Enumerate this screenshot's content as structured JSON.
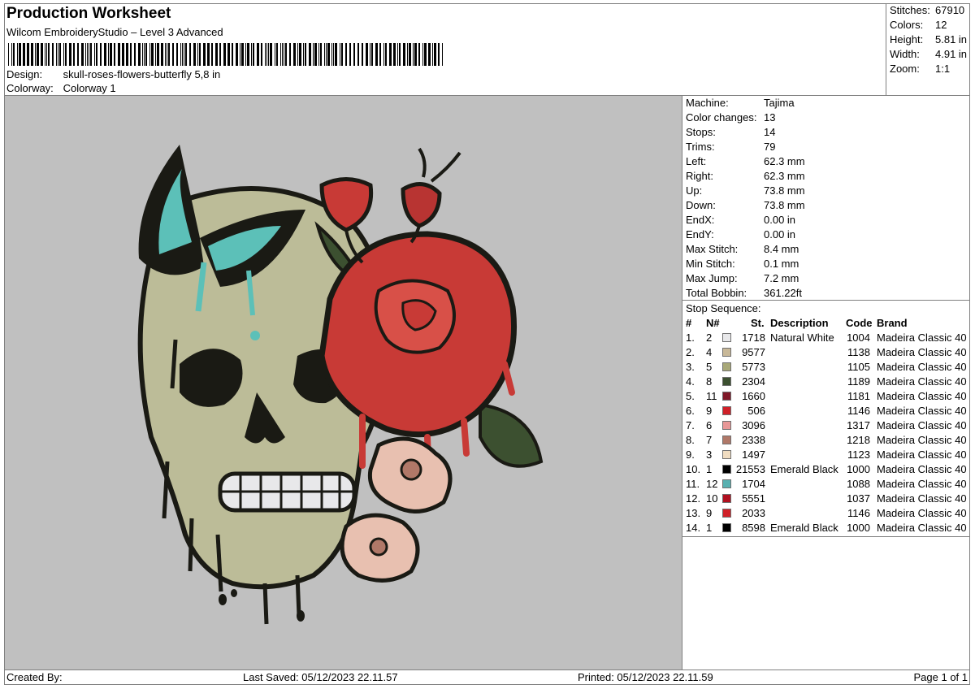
{
  "header": {
    "title": "Production Worksheet",
    "subtitle": "Wilcom EmbroideryStudio – Level 3 Advanced",
    "design_label": "Design:",
    "design_value": "skull-roses-flowers-butterfly 5,8 in",
    "colorway_label": "Colorway:",
    "colorway_value": "Colorway 1"
  },
  "stats": [
    {
      "label": "Stitches:",
      "value": "67910"
    },
    {
      "label": "Colors:",
      "value": "12"
    },
    {
      "label": "Height:",
      "value": "5.81 in"
    },
    {
      "label": "Width:",
      "value": "4.91 in"
    },
    {
      "label": "Zoom:",
      "value": "1:1"
    }
  ],
  "machine_info": [
    {
      "label": "Machine:",
      "value": "Tajima"
    },
    {
      "label": "Color changes:",
      "value": "13"
    },
    {
      "label": "Stops:",
      "value": "14"
    },
    {
      "label": "Trims:",
      "value": "79"
    },
    {
      "label": "Left:",
      "value": "62.3 mm"
    },
    {
      "label": "Right:",
      "value": "62.3 mm"
    },
    {
      "label": "Up:",
      "value": "73.8 mm"
    },
    {
      "label": "Down:",
      "value": "73.8 mm"
    },
    {
      "label": "EndX:",
      "value": "0.00 in"
    },
    {
      "label": "EndY:",
      "value": "0.00 in"
    },
    {
      "label": "Max Stitch:",
      "value": "8.4 mm"
    },
    {
      "label": "Min Stitch:",
      "value": "0.1 mm"
    },
    {
      "label": "Max Jump:",
      "value": "7.2 mm"
    },
    {
      "label": "Total Bobbin:",
      "value": "361.22ft"
    }
  ],
  "stop_sequence": {
    "title": "Stop Sequence:",
    "headers": {
      "num": "#",
      "n": "N#",
      "st": "St.",
      "desc": "Description",
      "code": "Code",
      "brand": "Brand"
    },
    "rows": [
      {
        "num": "1.",
        "n": "2",
        "color": "#e8e8ea",
        "st": "1718",
        "desc": "Natural White",
        "code": "1004",
        "brand": "Madeira Classic 40"
      },
      {
        "num": "2.",
        "n": "4",
        "color": "#c8b898",
        "st": "9577",
        "desc": "",
        "code": "1138",
        "brand": "Madeira Classic 40"
      },
      {
        "num": "3.",
        "n": "5",
        "color": "#a8a878",
        "st": "5773",
        "desc": "",
        "code": "1105",
        "brand": "Madeira Classic 40"
      },
      {
        "num": "4.",
        "n": "8",
        "color": "#3c5030",
        "st": "2304",
        "desc": "",
        "code": "1189",
        "brand": "Madeira Classic 40"
      },
      {
        "num": "5.",
        "n": "11",
        "color": "#801828",
        "st": "1660",
        "desc": "",
        "code": "1181",
        "brand": "Madeira Classic 40"
      },
      {
        "num": "6.",
        "n": "9",
        "color": "#d02028",
        "st": "506",
        "desc": "",
        "code": "1146",
        "brand": "Madeira Classic 40"
      },
      {
        "num": "7.",
        "n": "6",
        "color": "#e89898",
        "st": "3096",
        "desc": "",
        "code": "1317",
        "brand": "Madeira Classic 40"
      },
      {
        "num": "8.",
        "n": "7",
        "color": "#b07868",
        "st": "2338",
        "desc": "",
        "code": "1218",
        "brand": "Madeira Classic 40"
      },
      {
        "num": "9.",
        "n": "3",
        "color": "#f0dcc0",
        "st": "1497",
        "desc": "",
        "code": "1123",
        "brand": "Madeira Classic 40"
      },
      {
        "num": "10.",
        "n": "1",
        "color": "#000000",
        "st": "21553",
        "desc": "Emerald Black",
        "code": "1000",
        "brand": "Madeira Classic 40"
      },
      {
        "num": "11.",
        "n": "12",
        "color": "#58b0b0",
        "st": "1704",
        "desc": "",
        "code": "1088",
        "brand": "Madeira Classic 40"
      },
      {
        "num": "12.",
        "n": "10",
        "color": "#b01020",
        "st": "5551",
        "desc": "",
        "code": "1037",
        "brand": "Madeira Classic 40"
      },
      {
        "num": "13.",
        "n": "9",
        "color": "#d02028",
        "st": "2033",
        "desc": "",
        "code": "1146",
        "brand": "Madeira Classic 40"
      },
      {
        "num": "14.",
        "n": "1",
        "color": "#000000",
        "st": "8598",
        "desc": "Emerald Black",
        "code": "1000",
        "brand": "Madeira Classic 40"
      }
    ]
  },
  "footer": {
    "created_by": "Created By:",
    "last_saved": "Last Saved: 05/12/2023 22.11.57",
    "printed": "Printed: 05/12/2023 22.11.59",
    "page": "Page 1 of 1"
  },
  "colors": {
    "preview_bg": "#c0c0c0",
    "skull": "#bcbc98",
    "rose": "#c83a36",
    "butterfly": "#5cc0b8",
    "petal": "#e8c0b0",
    "leaf": "#3c5030",
    "outline": "#1a1a14"
  }
}
